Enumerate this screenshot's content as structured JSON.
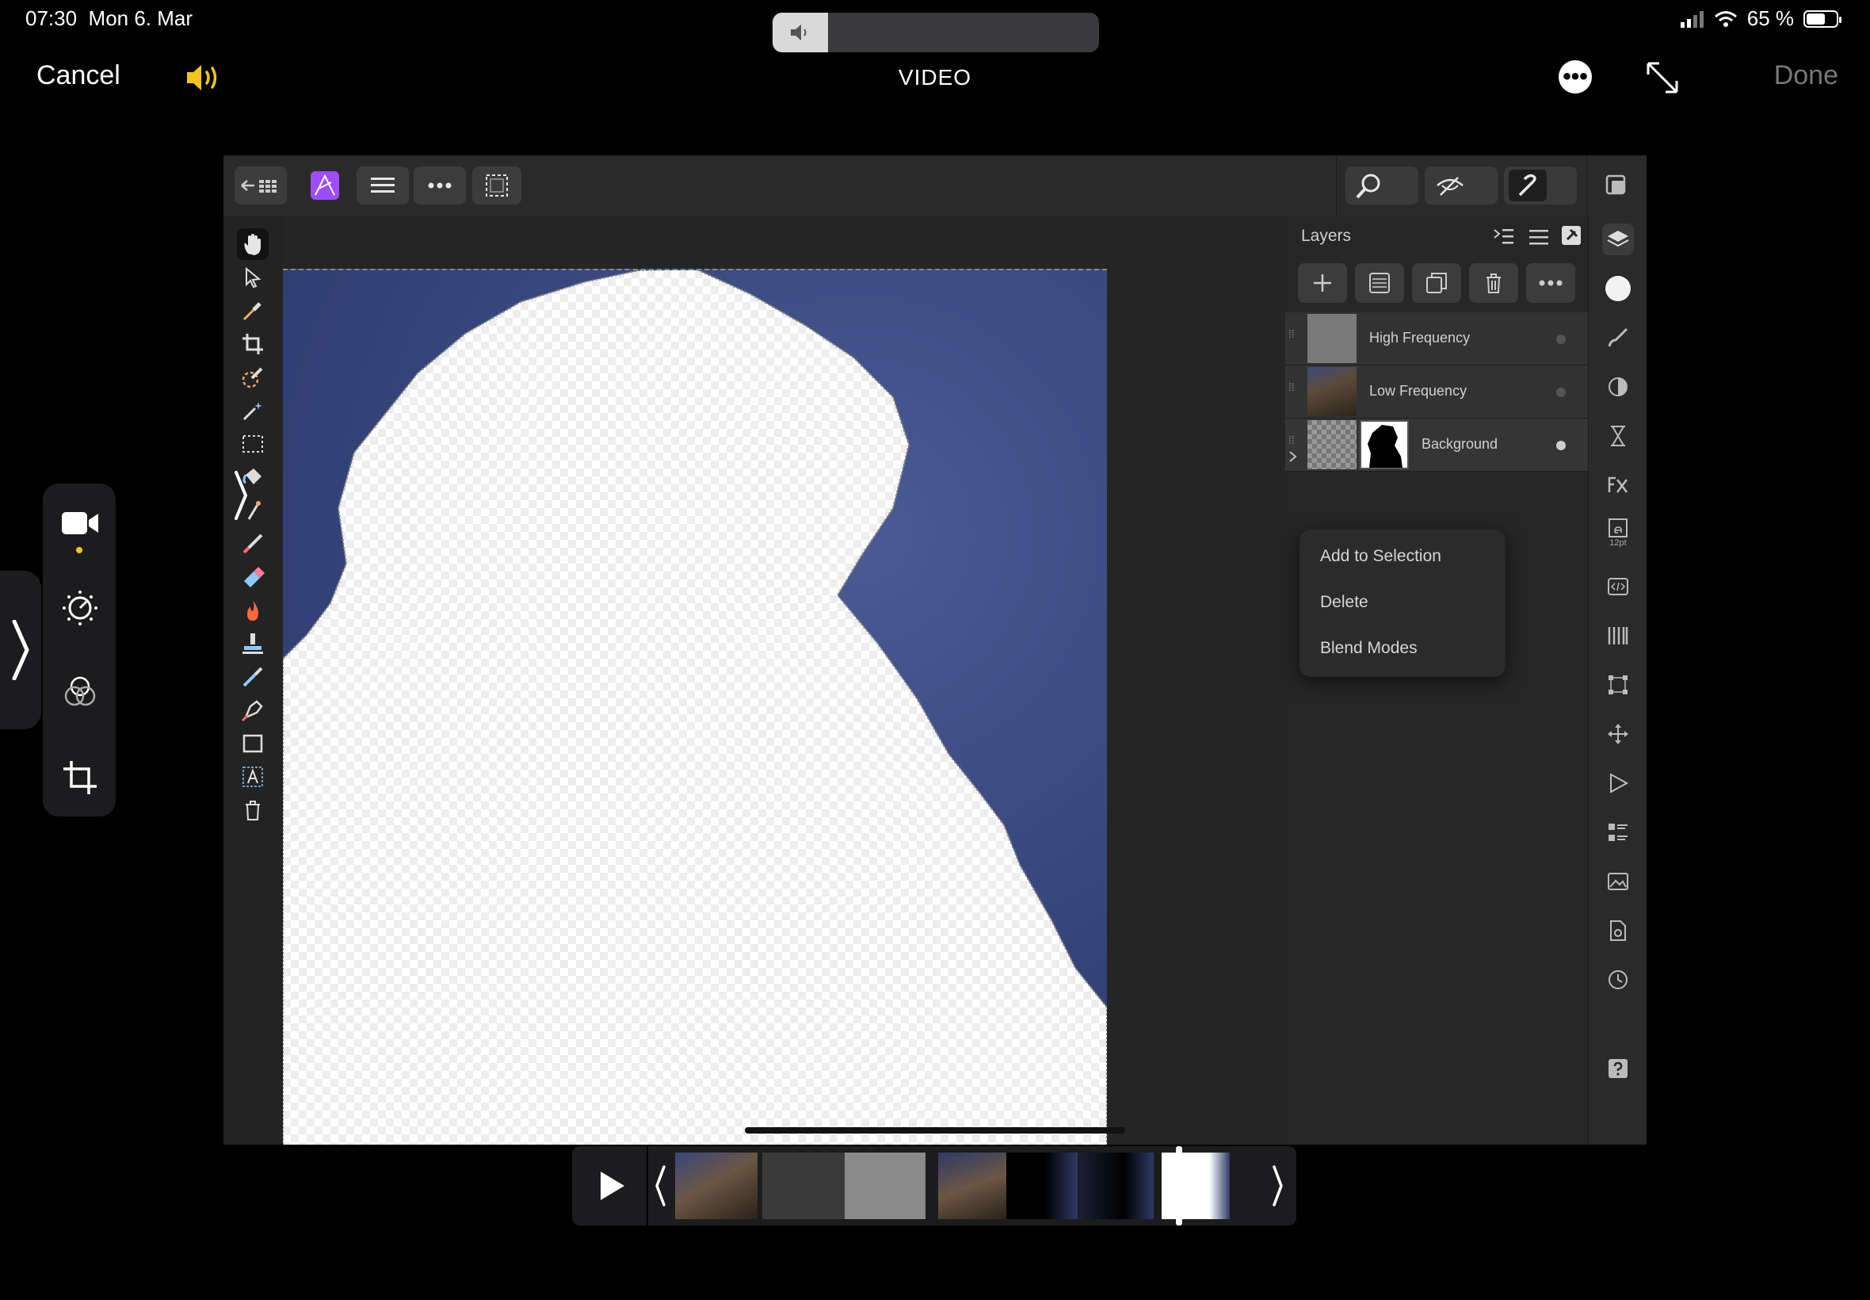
{
  "status_bar": {
    "time": "07:30",
    "date": "Mon 6. Mar",
    "battery_text": "65 %",
    "battery_level": 0.65
  },
  "volume_hud": {
    "level": 0.17
  },
  "video_editor": {
    "cancel_label": "Cancel",
    "title": "VIDEO",
    "done_label": "Done",
    "more_icon": "ellipsis-circle-icon",
    "expand_icon": "expand-arrows-icon",
    "speaker_icon": "speaker-wave-icon"
  },
  "app": {
    "name": "Affinity Photo",
    "layers_panel": {
      "title": "Layers",
      "layers": [
        {
          "name": "High Frequency",
          "visible_dot": true
        },
        {
          "name": "Low Frequency",
          "visible_dot": true
        },
        {
          "name": "Background",
          "visible_dot": true
        }
      ]
    },
    "context_menu": {
      "items": [
        "Add to Selection",
        "Delete",
        "Blend Modes"
      ]
    },
    "text_style_badge": "12pt"
  },
  "colors": {
    "accent_yellow": "#f5c518",
    "affinity_purple": "#9b4dff",
    "sky_blue": "#36467e"
  }
}
